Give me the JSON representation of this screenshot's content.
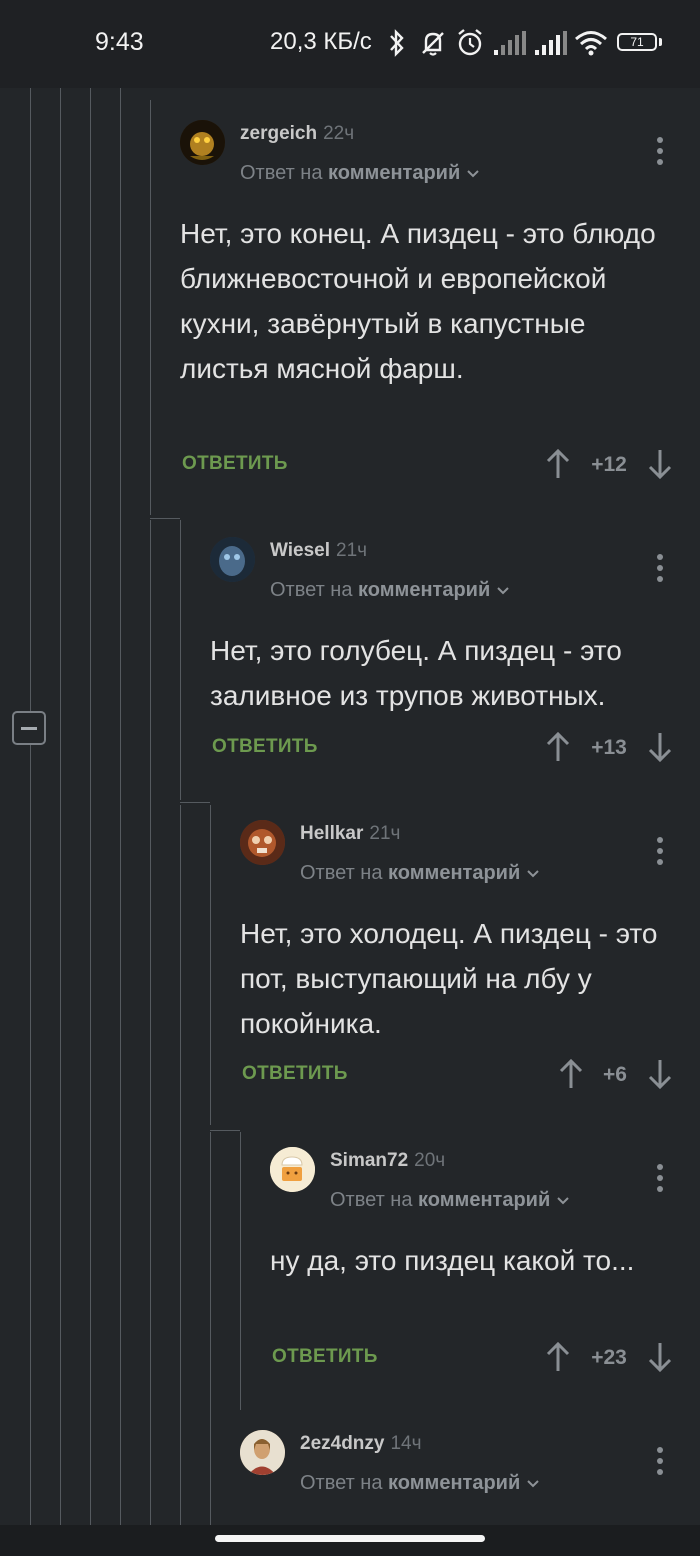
{
  "status": {
    "time": "9:43",
    "network_speed": "20,3 КБ/с",
    "battery": "71"
  },
  "comments": [
    {
      "author": "zergeich",
      "time": "22ч",
      "reply_prefix": "Ответ на",
      "reply_target": "комментарий",
      "text": "Нет, это конец. А пиздец - это блюдо ближневосточной и европейской кухни, завёрнутый в капустные листья мясной фарш.",
      "reply_label": "ОТВЕТИТЬ",
      "score": "+12",
      "avatar_icon": "avatar-yellow-creature",
      "avatar_color": "#3a2a10"
    },
    {
      "author": "Wiesel",
      "time": "21ч",
      "reply_prefix": "Ответ на",
      "reply_target": "комментарий",
      "text": "Нет, это голубец. А пиздец - это заливное из трупов животных.",
      "reply_label": "ОТВЕТИТЬ",
      "score": "+13",
      "avatar_icon": "avatar-blue-face",
      "avatar_color": "#2a3a4a"
    },
    {
      "author": "Hellkar",
      "time": "21ч",
      "reply_prefix": "Ответ на",
      "reply_target": "комментарий",
      "text": "Нет, это холодец. А пиздец - это пот, выступающий на лбу у покойника.",
      "reply_label": "ОТВЕТИТЬ",
      "score": "+6",
      "avatar_icon": "avatar-orange-creature",
      "avatar_color": "#7a3a20"
    },
    {
      "author": "Siman72",
      "time": "20ч",
      "reply_prefix": "Ответ на",
      "reply_target": "комментарий",
      "text": "ну да, это пиздец какой то...",
      "reply_label": "ОТВЕТИТЬ",
      "score": "+23",
      "avatar_icon": "avatar-chef-cake",
      "avatar_color": "#f2e6c8"
    },
    {
      "author": "2ez4dnzy",
      "time": "14ч",
      "reply_prefix": "Ответ на",
      "reply_target": "комментарий",
      "avatar_icon": "avatar-portrait",
      "avatar_color": "#c8a070"
    }
  ],
  "colors": {
    "background": "#232629",
    "reply_green": "#6d9a4f",
    "thread_line": "#555a5f"
  }
}
